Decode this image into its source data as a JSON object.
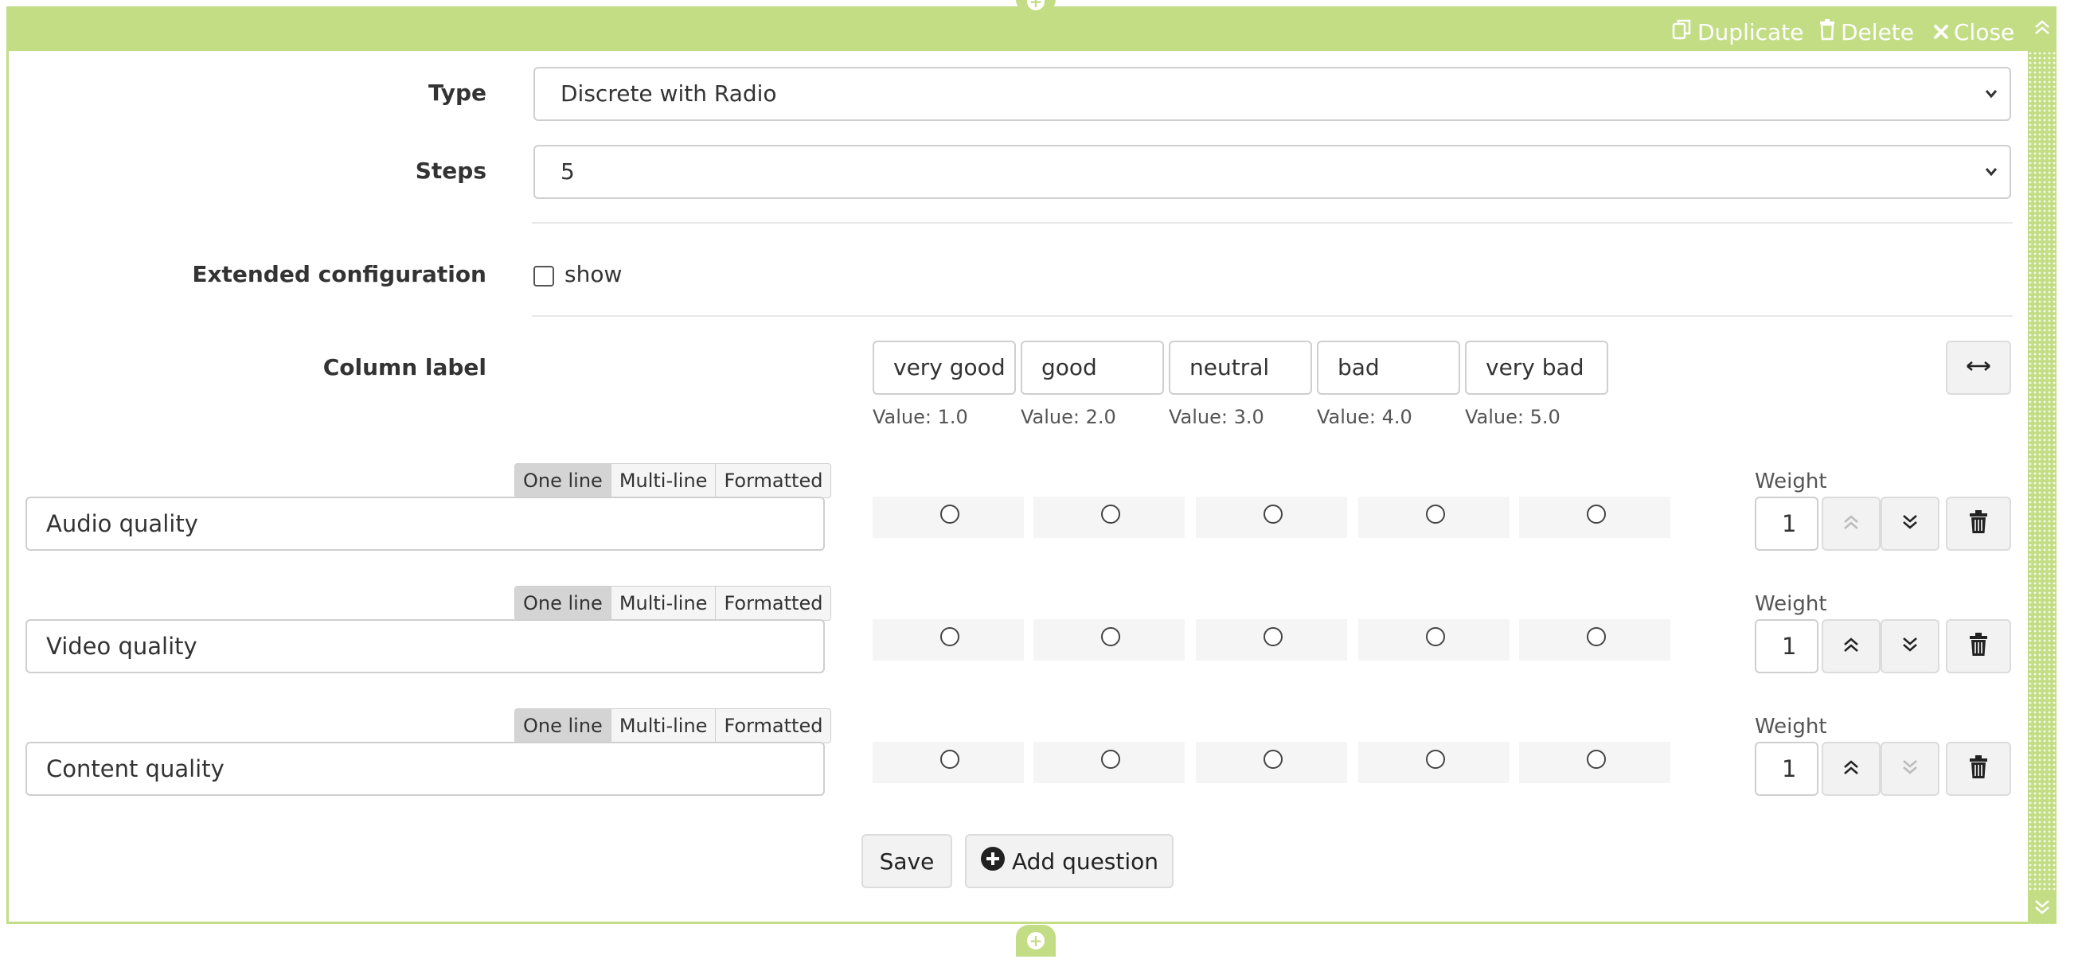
{
  "toolbar": {
    "duplicate_label": "Duplicate",
    "delete_label": "Delete",
    "close_label": "Close"
  },
  "form": {
    "type_label": "Type",
    "type_value": "Discrete with Radio",
    "steps_label": "Steps",
    "steps_value": "5",
    "extended_label": "Extended configuration",
    "extended_checkbox_label": "show",
    "extended_checked": false,
    "column_label_label": "Column label"
  },
  "columns": [
    {
      "label": "very good",
      "value": "Value: 1.0"
    },
    {
      "label": "good",
      "value": "Value: 2.0"
    },
    {
      "label": "neutral",
      "value": "Value: 3.0"
    },
    {
      "label": "bad",
      "value": "Value: 4.0"
    },
    {
      "label": "very bad",
      "value": "Value: 5.0"
    }
  ],
  "modes": [
    "One line",
    "Multi-line",
    "Formatted"
  ],
  "questions": [
    {
      "text": "Audio quality",
      "mode": "One line",
      "weight_label": "Weight",
      "weight": "1",
      "up_enabled": false,
      "down_enabled": true
    },
    {
      "text": "Video quality",
      "mode": "One line",
      "weight_label": "Weight",
      "weight": "1",
      "up_enabled": true,
      "down_enabled": true
    },
    {
      "text": "Content quality",
      "mode": "One line",
      "weight_label": "Weight",
      "weight": "1",
      "up_enabled": true,
      "down_enabled": false
    }
  ],
  "actions": {
    "save_label": "Save",
    "add_question_label": "Add question"
  },
  "colors": {
    "accent": "#c3dd85"
  }
}
